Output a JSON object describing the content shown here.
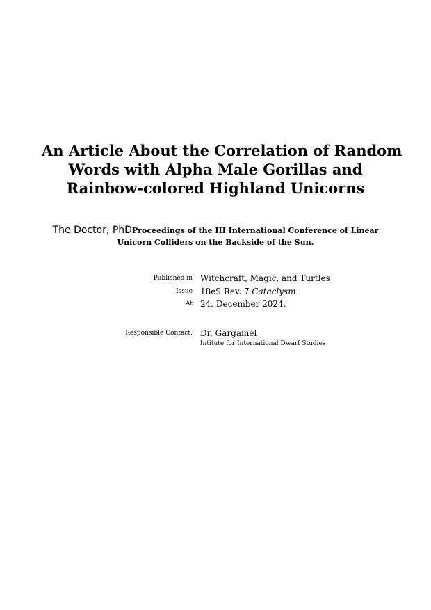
{
  "title_lines": [
    "An Article About the Correlation of Random",
    "Words with Alpha Male Gorillas and",
    "Rainbow-colored Highland Unicorns"
  ],
  "author": "The Doctor, PhD",
  "proceedings": {
    "line1": "Proceedings of the III International Conference of Linear",
    "line2": "Unicorn Colliders on the Backside of the Sun."
  },
  "publication": {
    "published_in_label": "Published in",
    "published_in_value": "Witchcraft, Magic, and Turtles",
    "issue_label": "Issue",
    "issue_value": "18e9 Rev. 7",
    "issue_name": "Cataclysm",
    "at_label": "At",
    "at_value": "24. December 2024."
  },
  "contact": {
    "label": "Responsible Contact:",
    "name": "Dr. Gargamel",
    "institution": "Intitute for International Dwarf Studies"
  }
}
